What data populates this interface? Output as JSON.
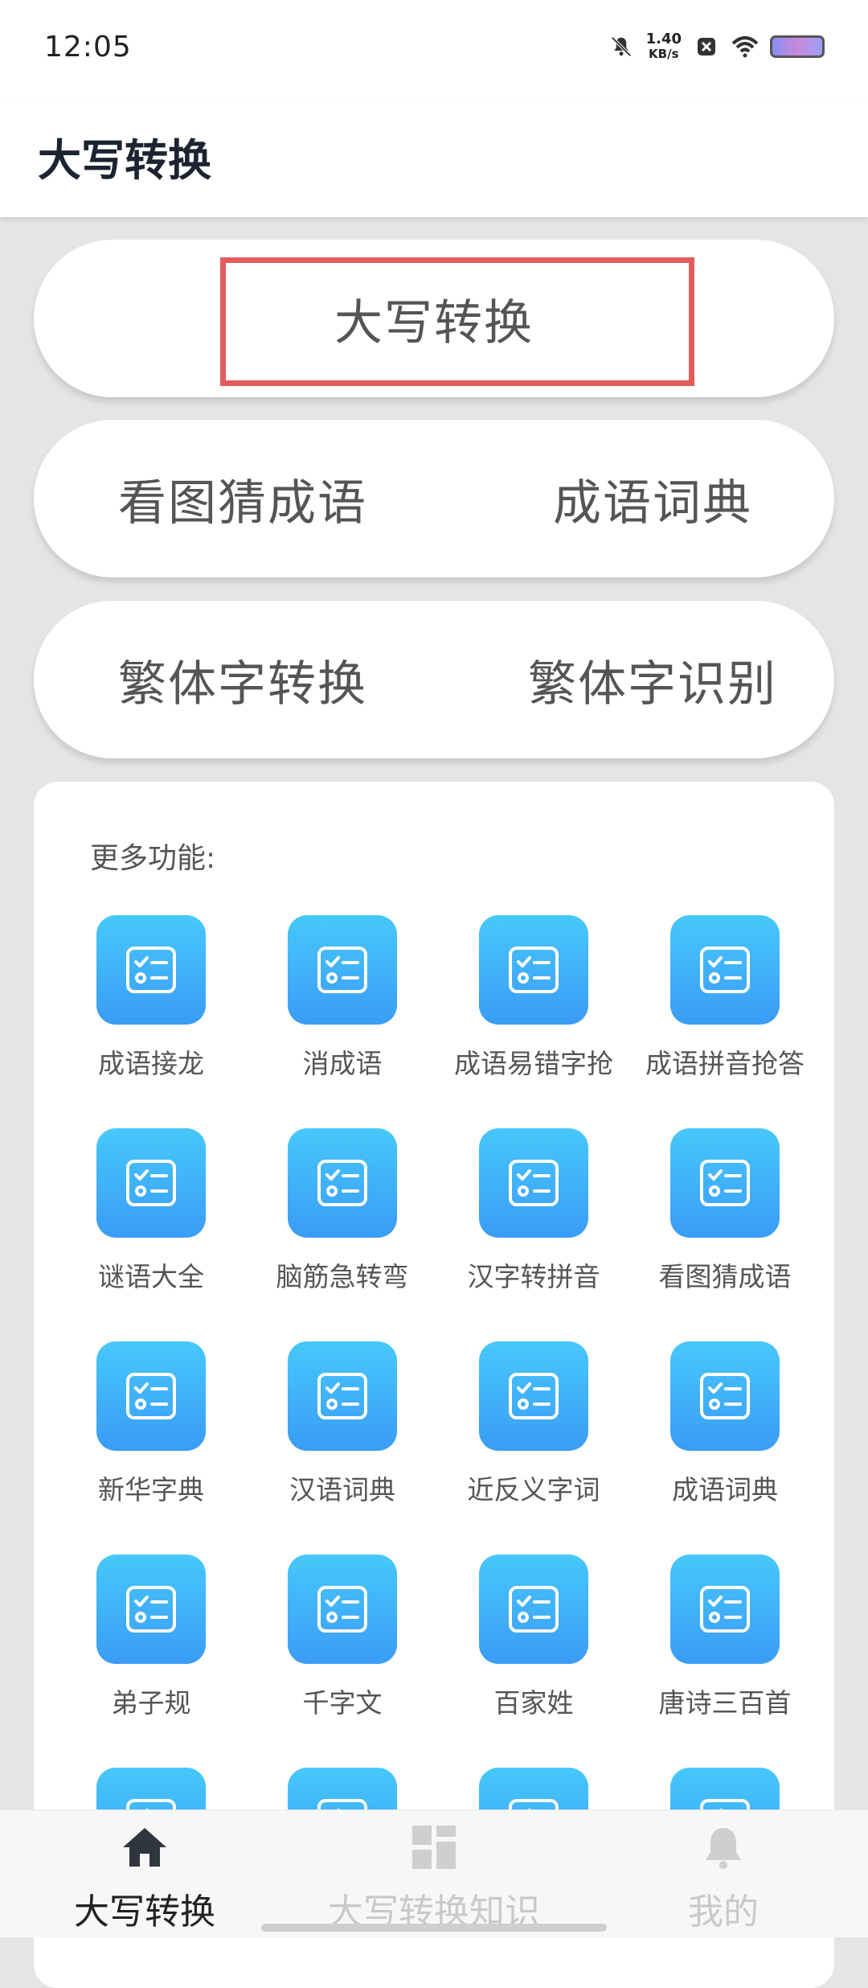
{
  "status_bar": {
    "time": "12:05",
    "speed_value": "1.40",
    "speed_unit": "KB/s",
    "icons": [
      "bell-muted-icon",
      "close-box-icon",
      "wifi-icon",
      "battery-icon"
    ]
  },
  "app_bar": {
    "title": "大写转换"
  },
  "feature_buttons": {
    "row1": {
      "center": "大写转换"
    },
    "row2": {
      "left": "看图猜成语",
      "right": "成语词典"
    },
    "row3": {
      "left": "繁体字转换",
      "right": "繁体字识别"
    }
  },
  "more_functions": {
    "title": "更多功能:",
    "items": [
      {
        "label": "成语接龙"
      },
      {
        "label": "消成语"
      },
      {
        "label": "成语易错字抢"
      },
      {
        "label": "成语拼音抢答"
      },
      {
        "label": "谜语大全"
      },
      {
        "label": "脑筋急转弯"
      },
      {
        "label": "汉字转拼音"
      },
      {
        "label": "看图猜成语"
      },
      {
        "label": "新华字典"
      },
      {
        "label": "汉语词典"
      },
      {
        "label": "近反义字词"
      },
      {
        "label": "成语词典"
      },
      {
        "label": "弟子规"
      },
      {
        "label": "千字文"
      },
      {
        "label": "百家姓"
      },
      {
        "label": "唐诗三百首"
      }
    ]
  },
  "bottom_nav": {
    "items": [
      {
        "label": "大写转换",
        "icon": "home-icon",
        "active": true
      },
      {
        "label": "大写转换知识",
        "icon": "grid-icon",
        "active": false
      },
      {
        "label": "我的",
        "icon": "bell-icon",
        "active": false
      }
    ]
  },
  "colors": {
    "accent_top": "#47c8fb",
    "accent_bottom": "#3a9cf6",
    "highlight": "#e25c5c",
    "background": "#e5e5e5"
  }
}
